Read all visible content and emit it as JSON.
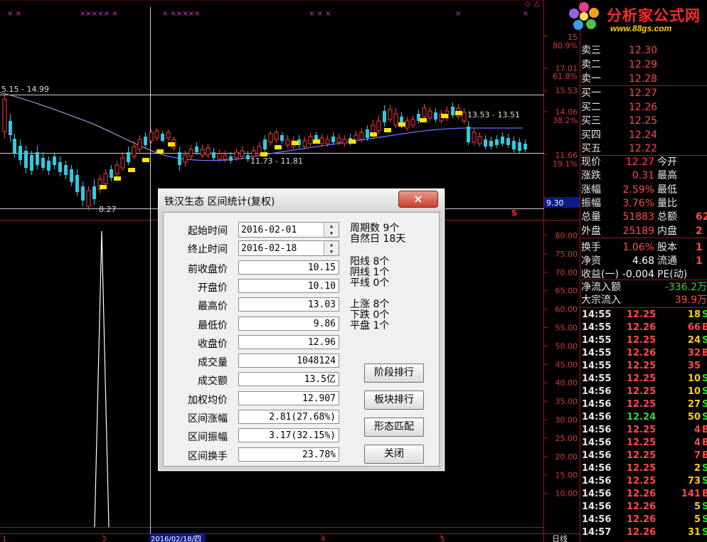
{
  "logo": {
    "name": "分析家公式网",
    "url": "www.88gs.com"
  },
  "chart": {
    "top_marks": [
      "× ×",
      "××××× ×",
      "× ×××××",
      "× × ×",
      "×",
      "×"
    ],
    "price_ticks": [
      "15",
      "80.9%",
      "17.01",
      "61.8%",
      "15.53",
      "14.06",
      "38.2%",
      "11.66",
      "19.1%",
      "9.30"
    ],
    "annotations": {
      "hi_line": "5.15 - 14.99",
      "mid": "11.73 - 11.81",
      "right": "13.53 - 13.51",
      "low": "8.27",
      "s_mark": "S"
    },
    "indicator_ticks": [
      "80.00",
      "75.00",
      "70.00",
      "65.00",
      "60.00",
      "55.00",
      "50.00",
      "45.00",
      "40.00",
      "35.00",
      "30.00",
      "25.00",
      "20.00",
      "15.00",
      "10.00"
    ],
    "date_ticks": [
      "1",
      "2",
      "2016/02/18/四",
      "4",
      "5"
    ],
    "period_label": "日线"
  },
  "quote": {
    "sells": [
      {
        "label": "卖三",
        "price": "12.30"
      },
      {
        "label": "卖二",
        "price": "12.29"
      },
      {
        "label": "卖一",
        "price": "12.28"
      }
    ],
    "buys": [
      {
        "label": "买一",
        "price": "12.27"
      },
      {
        "label": "买二",
        "price": "12.26"
      },
      {
        "label": "买三",
        "price": "12.25"
      },
      {
        "label": "买四",
        "price": "12.24"
      },
      {
        "label": "买五",
        "price": "12.22"
      }
    ],
    "stats": [
      {
        "l1": "现价",
        "v1": "12.27",
        "l2": "今开"
      },
      {
        "l1": "涨跌",
        "v1": "0.31",
        "l2": "最高"
      },
      {
        "l1": "涨幅",
        "v1": "2.59%",
        "l2": "最低"
      },
      {
        "l1": "振幅",
        "v1": "3.76%",
        "l2": "量比"
      },
      {
        "l1": "总量",
        "v1": "51883",
        "l2": "总额",
        "v2": "62"
      },
      {
        "l1": "外盘",
        "v1": "25189",
        "l2": "内盘",
        "v2": "2"
      },
      {
        "l1": "换手",
        "v1": "1.06%",
        "l2": "股本",
        "v2": "1"
      },
      {
        "l1": "净资",
        "v1": "4.68",
        "l2": "流通",
        "v2": "1"
      },
      {
        "l1": "收益(一)",
        "v1": "-0.004",
        "l2": "PE(动)"
      }
    ],
    "flows": [
      {
        "label": "净流入额",
        "value": "-336.2万"
      },
      {
        "label": "大宗流入",
        "value": "39.9万"
      }
    ],
    "ticks": [
      {
        "time": "14:55",
        "price": "12.25",
        "vol": "18",
        "side": "S"
      },
      {
        "time": "14:55",
        "price": "12.26",
        "vol": "66",
        "side": "B"
      },
      {
        "time": "14:55",
        "price": "12.25",
        "vol": "24",
        "side": "S"
      },
      {
        "time": "14:55",
        "price": "12.26",
        "vol": "32",
        "side": "B"
      },
      {
        "time": "14:55",
        "price": "12.25",
        "vol": "35",
        "side": ""
      },
      {
        "time": "14:55",
        "price": "12.25",
        "vol": "10",
        "side": "S"
      },
      {
        "time": "14:56",
        "price": "12.25",
        "vol": "10",
        "side": "S"
      },
      {
        "time": "14:56",
        "price": "12.25",
        "vol": "27",
        "side": "S"
      },
      {
        "time": "14:56",
        "price": "12.24",
        "vol": "50",
        "side": "S"
      },
      {
        "time": "14:56",
        "price": "12.25",
        "vol": "4",
        "side": "B"
      },
      {
        "time": "14:56",
        "price": "12.25",
        "vol": "4",
        "side": "B"
      },
      {
        "time": "14:56",
        "price": "12.25",
        "vol": "7",
        "side": "B"
      },
      {
        "time": "14:56",
        "price": "12.25",
        "vol": "2",
        "side": "S"
      },
      {
        "time": "14:56",
        "price": "12.25",
        "vol": "73",
        "side": "S"
      },
      {
        "time": "14:56",
        "price": "12.26",
        "vol": "141",
        "side": "B"
      },
      {
        "time": "14:56",
        "price": "12.26",
        "vol": "5",
        "side": "S"
      },
      {
        "time": "14:56",
        "price": "12.26",
        "vol": "5",
        "side": "S"
      },
      {
        "time": "14:57",
        "price": "12.26",
        "vol": "31",
        "side": "S"
      }
    ]
  },
  "dialog": {
    "title": "铁汉生态 区间统计(复权)",
    "close": "×",
    "fields": [
      {
        "label": "起始时间",
        "value": "2016-02-01"
      },
      {
        "label": "终止时间",
        "value": "2016-02-18"
      },
      {
        "label": "前收盘价",
        "value": "10.15"
      },
      {
        "label": "开盘价",
        "value": "10.10"
      },
      {
        "label": "最高价",
        "value": "13.03"
      },
      {
        "label": "最低价",
        "value": "9.86"
      },
      {
        "label": "收盘价",
        "value": "12.96"
      },
      {
        "label": "成交量",
        "value": "1048124"
      },
      {
        "label": "成交额",
        "value": "13.5亿"
      },
      {
        "label": "加权均价",
        "value": "12.907"
      },
      {
        "label": "区间涨幅",
        "value": "2.81(27.68%)"
      },
      {
        "label": "区间振幅",
        "value": "3.17(32.15%)"
      },
      {
        "label": "区间换手",
        "value": "23.78%"
      }
    ],
    "stats": [
      {
        "label": "周期数",
        "value": "9个"
      },
      {
        "label": "自然日",
        "value": "18天"
      },
      {
        "label": "阳线",
        "value": "8个"
      },
      {
        "label": "阴线",
        "value": "1个"
      },
      {
        "label": "平线",
        "value": "0个"
      },
      {
        "label": "上涨",
        "value": "8个"
      },
      {
        "label": "下跌",
        "value": "0个"
      },
      {
        "label": "平盘",
        "value": "1个"
      }
    ],
    "buttons": [
      "阶段排行",
      "板块排行",
      "形态匹配",
      "关闭"
    ]
  }
}
